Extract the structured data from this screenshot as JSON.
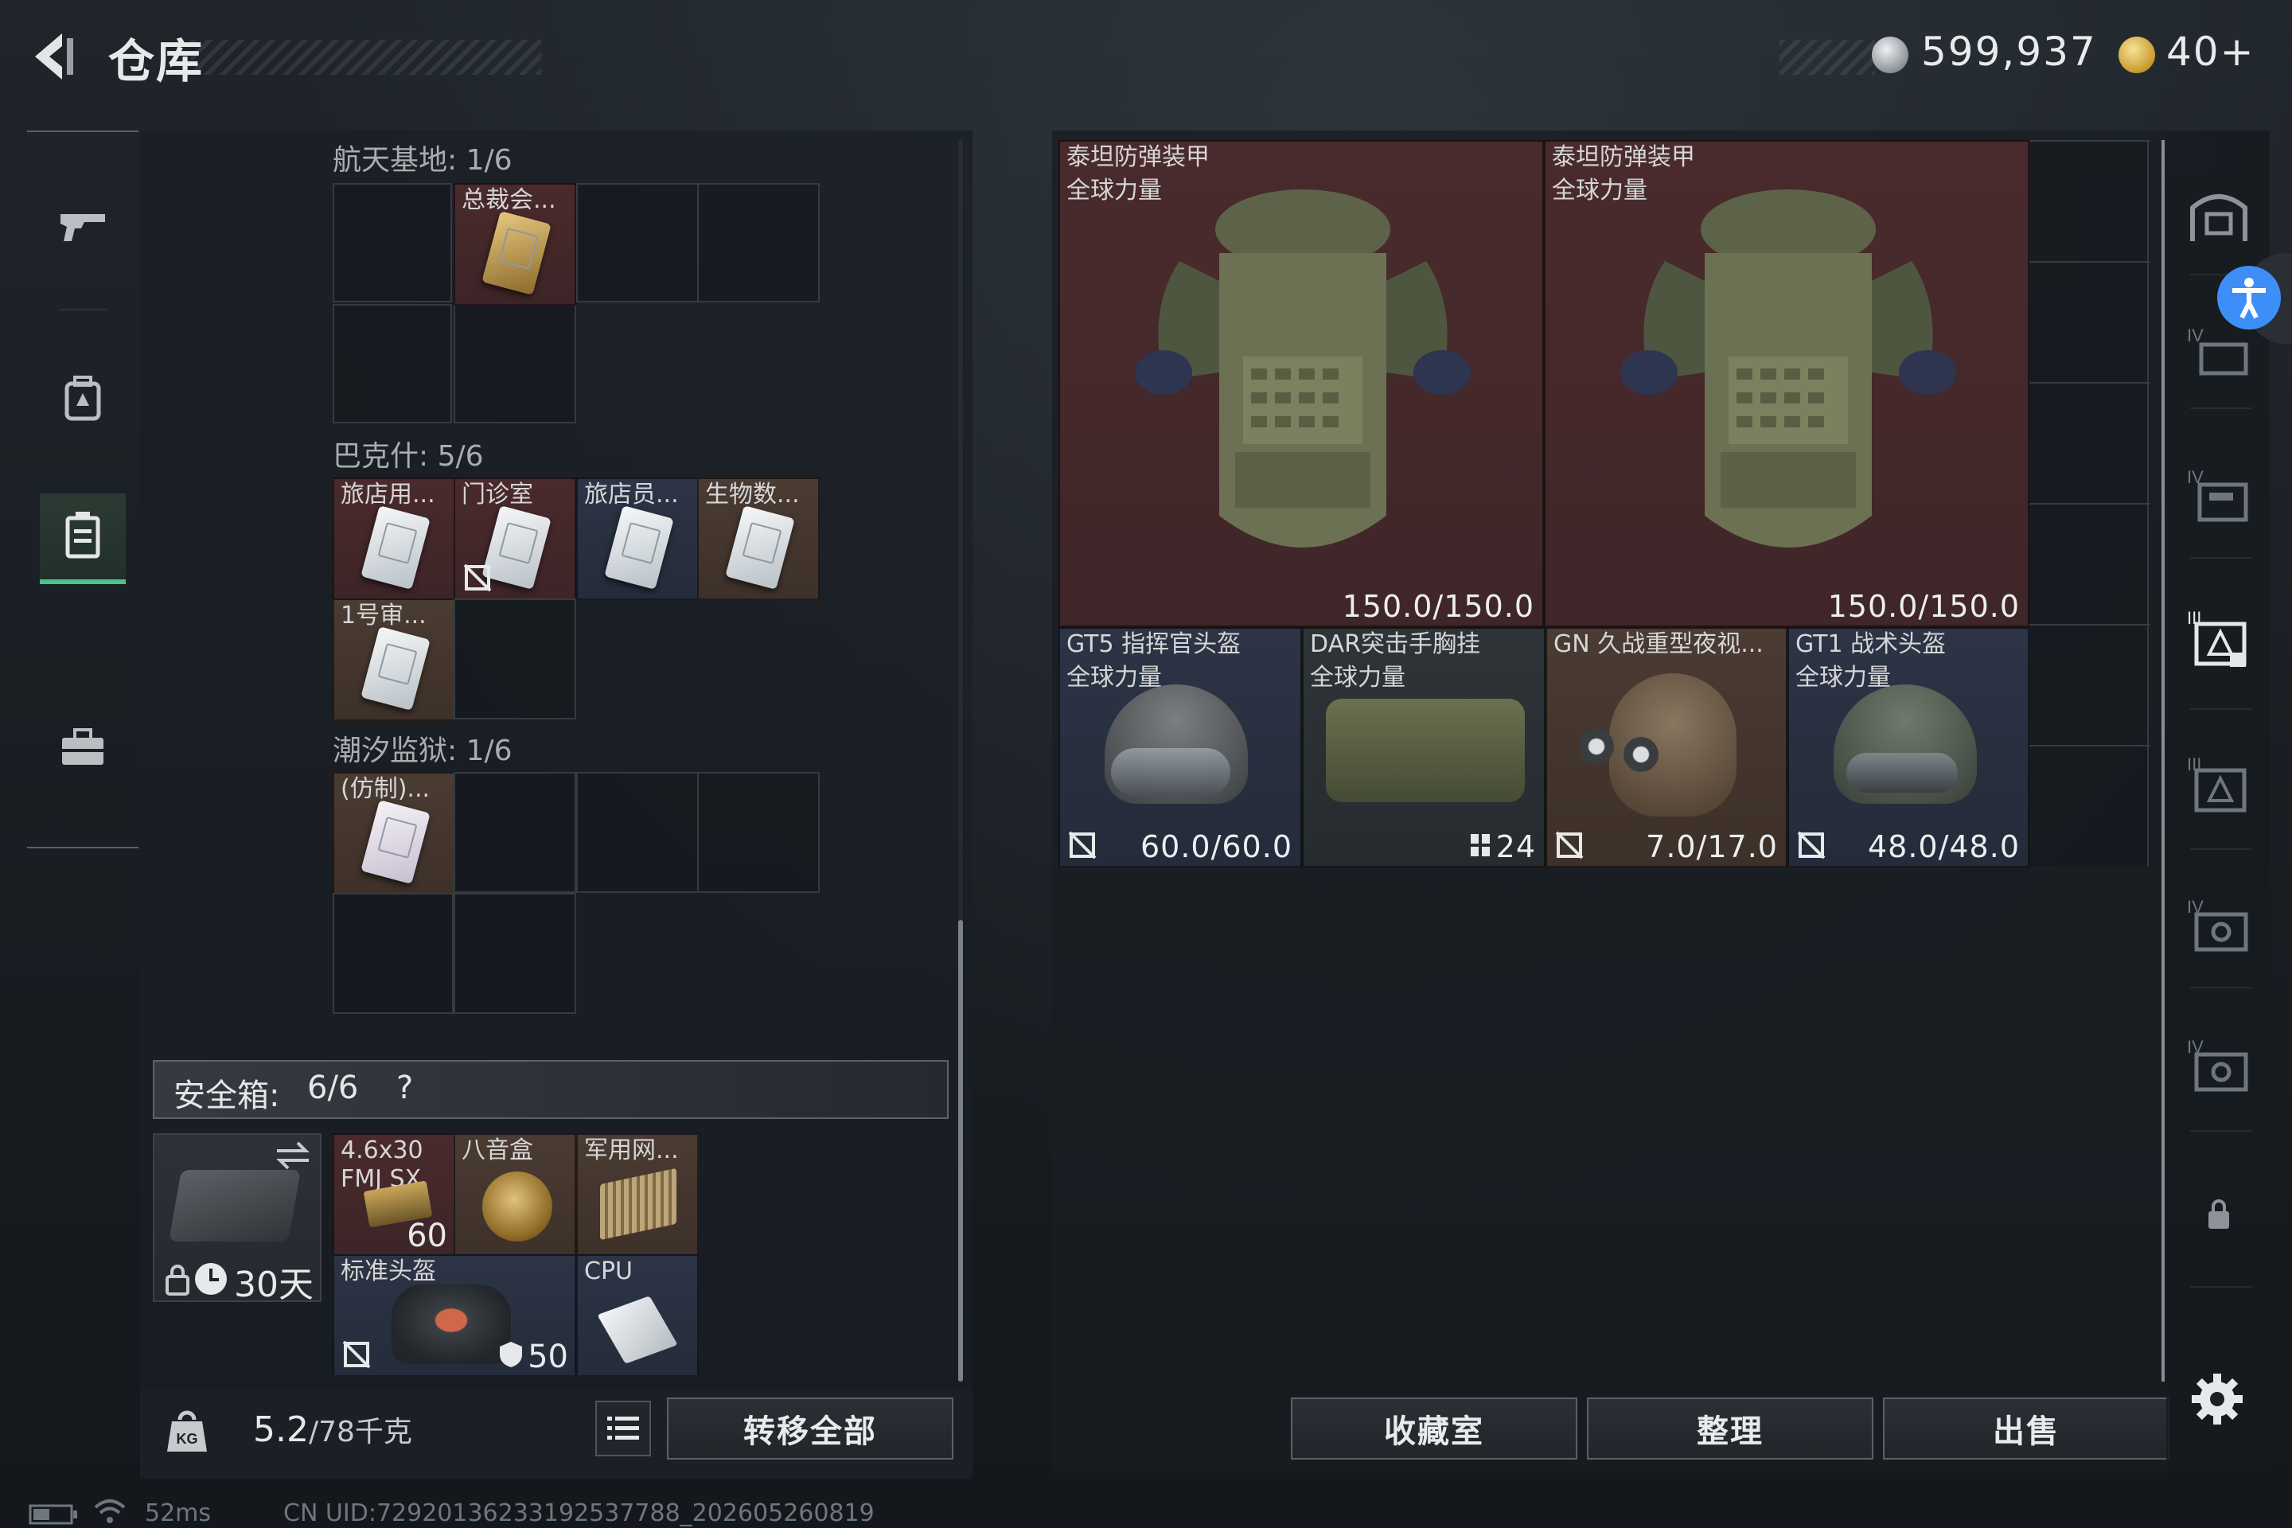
{
  "header": {
    "title": "仓库"
  },
  "currency": {
    "silver": "599,937",
    "gold": "40+"
  },
  "left_nav": [
    {
      "name": "weapons"
    },
    {
      "name": "equipment"
    },
    {
      "name": "keycards",
      "active": true
    },
    {
      "name": "cases"
    }
  ],
  "sections": [
    {
      "label": "航天基地: 1/6",
      "items": [
        {
          "label": "总裁会..."
        }
      ]
    },
    {
      "label": "巴克什: 5/6",
      "items": [
        {
          "label": "旅店用..."
        },
        {
          "label": "门诊室"
        },
        {
          "label": "旅店员..."
        },
        {
          "label": "生物数..."
        },
        {
          "label": "1号审..."
        }
      ]
    },
    {
      "label": "潮汐监狱: 1/6",
      "items": [
        {
          "label": "(仿制)..."
        }
      ]
    }
  ],
  "safe_box": {
    "title": "安全箱:",
    "count": "6/6",
    "help": "?",
    "days": "30天",
    "items": [
      {
        "label": "4.6x30 FMJ SX",
        "count": "60"
      },
      {
        "label": "八音盒"
      },
      {
        "label": "军用网..."
      },
      {
        "label": "标准头盔",
        "count": "50"
      },
      {
        "label": "CPU"
      }
    ]
  },
  "bottom_left": {
    "weight": "5.2",
    "capacity": "/78千克",
    "transfer_label": "转移全部"
  },
  "gear": [
    {
      "name": "泰坦防弹装甲",
      "sub": "全球力量",
      "durability": "150.0/150.0"
    },
    {
      "name": "泰坦防弹装甲",
      "sub": "全球力量",
      "durability": "150.0/150.0"
    },
    {
      "name": "GT5 指挥官头盔",
      "sub": "全球力量",
      "durability": "60.0/60.0"
    },
    {
      "name": "DAR突击手胸挂",
      "sub": "全球力量",
      "capacity": "24"
    },
    {
      "name": "GN 久战重型夜视...",
      "durability": "7.0/17.0"
    },
    {
      "name": "GT1 战术头盔",
      "sub": "全球力量",
      "durability": "48.0/48.0"
    }
  ],
  "actions": {
    "collection": "收藏室",
    "sort": "整理",
    "sell": "出售"
  },
  "status_bar": {
    "ping": "52ms",
    "uid": "CN UID:7292013623319253​7788_202605260819"
  },
  "colors": {
    "accent_green": "#4fc28a",
    "accessibility_blue": "#3e8ef7",
    "item_red": "#4a2a2c"
  }
}
